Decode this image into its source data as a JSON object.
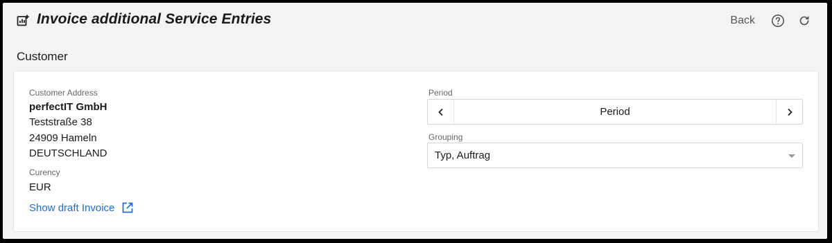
{
  "header": {
    "title": "Invoice additional Service Entries",
    "title_icon": "add-chart-icon",
    "back_label": "Back",
    "help_icon": "help-circle-icon",
    "refresh_icon": "refresh-icon"
  },
  "section": {
    "title": "Customer"
  },
  "customer": {
    "address_label": "Customer Address",
    "name": "perfectIT GmbH",
    "street": "Teststraße 38",
    "city": "24909 Hameln",
    "country": "DEUTSCHLAND",
    "currency_label": "Curency",
    "currency": "EUR",
    "draft_link": "Show draft Invoice",
    "draft_link_icon": "open-in-new-icon"
  },
  "period": {
    "label": "Period",
    "value": "Period",
    "prev_icon": "chevron-left-icon",
    "next_icon": "chevron-right-icon"
  },
  "grouping": {
    "label": "Grouping",
    "selected": "Typ, Auftrag"
  },
  "colors": {
    "link": "#1a6ed8",
    "background": "#f3f4f6",
    "card": "#ffffff"
  }
}
